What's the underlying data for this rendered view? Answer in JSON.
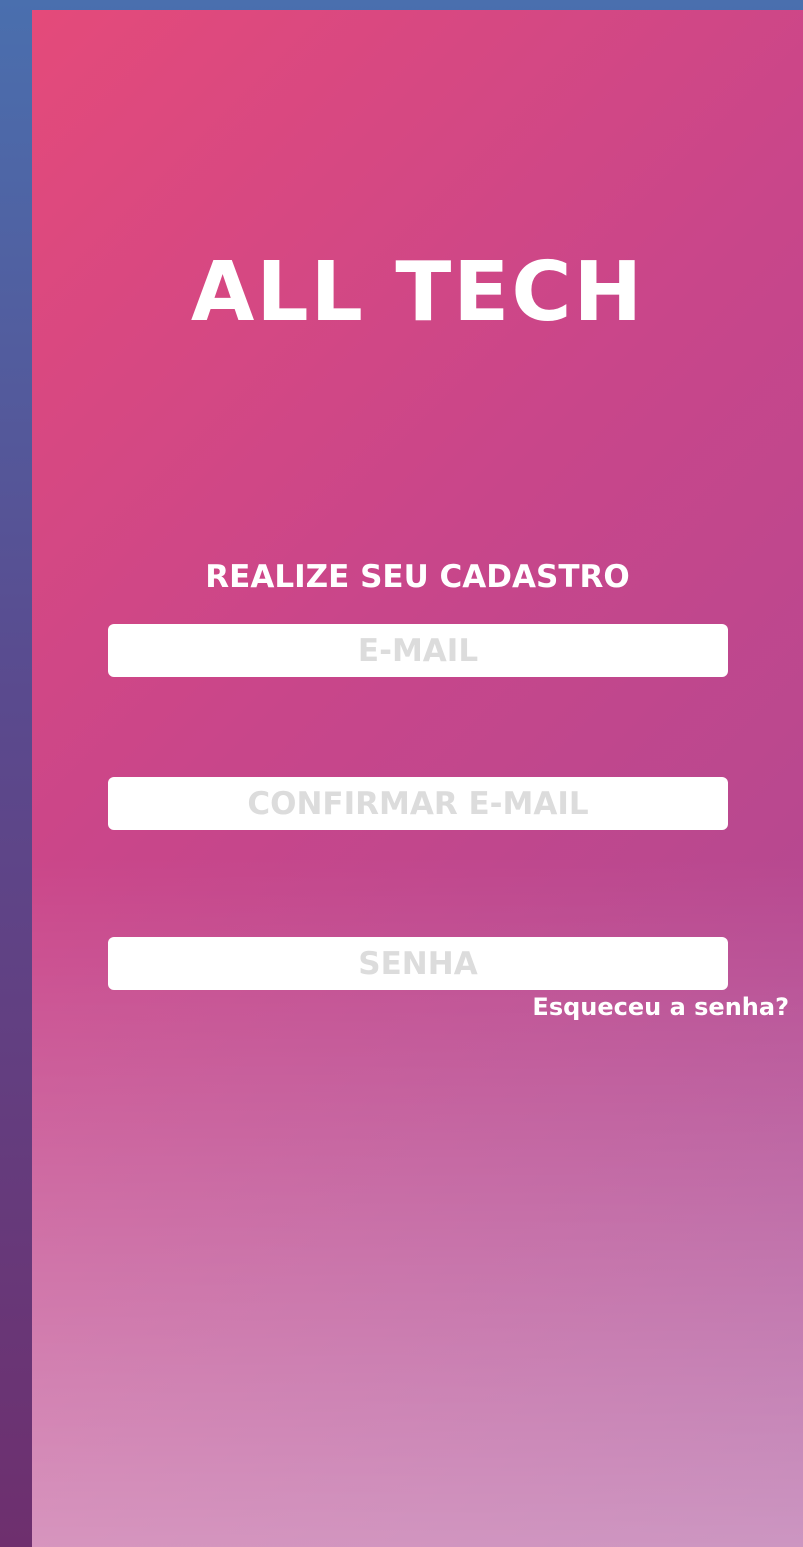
{
  "app": {
    "title": "ALL TECH"
  },
  "form": {
    "heading": "REALIZE SEU CADASTRO",
    "email": {
      "value": "",
      "placeholder": "E-MAIL"
    },
    "confirm_email": {
      "value": "",
      "placeholder": "CONFIRMAR E-MAIL"
    },
    "password": {
      "value": "",
      "placeholder": "SENHA"
    },
    "forgot_password_label": "Esqueceu a senha?"
  },
  "colors": {
    "gradient_start": "#e44a7a",
    "gradient_end": "#a74a95",
    "outer_background_top": "#4a6fae",
    "outer_background_bottom": "#6e2f6e",
    "text": "#ffffff",
    "field_background": "#ffffff",
    "placeholder": "#dcdcdc"
  }
}
